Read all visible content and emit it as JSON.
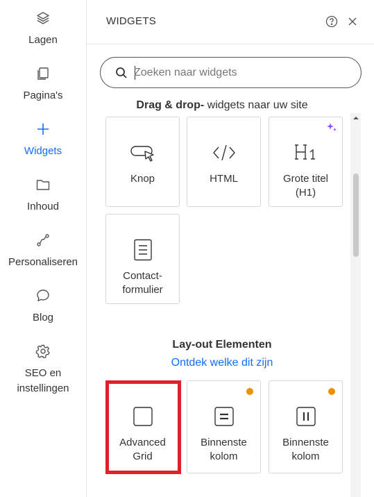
{
  "rail": {
    "items": [
      {
        "label": "Lagen",
        "icon": "layers-icon"
      },
      {
        "label": "Pagina's",
        "icon": "pages-icon"
      },
      {
        "label": "Widgets",
        "icon": "plus-icon",
        "active": true
      },
      {
        "label": "Inhoud",
        "icon": "folder-icon"
      },
      {
        "label": "Personaliseren",
        "icon": "path-icon"
      },
      {
        "label": "Blog",
        "icon": "chat-bubble-icon"
      },
      {
        "label": "SEO en instellingen",
        "icon": "gear-icon"
      }
    ]
  },
  "panel": {
    "title": "WIDGETS",
    "search_placeholder": "Zoeken naar widgets"
  },
  "section1": {
    "title_bold": "Drag & drop-",
    "title_rest": " widgets naar uw site",
    "cards": [
      {
        "label": "Knop",
        "icon": "button-cursor-icon"
      },
      {
        "label": "HTML",
        "icon": "code-icon"
      },
      {
        "label": "Grote titel (H1)",
        "icon": "heading-h1-icon",
        "badge": "sparkle"
      },
      {
        "label": "Contact-formulier",
        "icon": "form-icon"
      }
    ]
  },
  "section2": {
    "title": "Lay-out Elementen",
    "link": "Ontdek welke dit zijn",
    "cards": [
      {
        "label": "Advanced Grid",
        "icon": "square-icon",
        "highlighted": true
      },
      {
        "label": "Binnenste kolom",
        "icon": "inner-column-icon",
        "badge": "dot"
      },
      {
        "label": "Binnenste kolom",
        "icon": "inner-columns-split-icon",
        "badge": "dot"
      }
    ]
  },
  "colors": {
    "accent": "#116dff",
    "badge_dot": "#f28c00",
    "highlight": "#e0202a",
    "sparkle": "#8a4dff"
  }
}
